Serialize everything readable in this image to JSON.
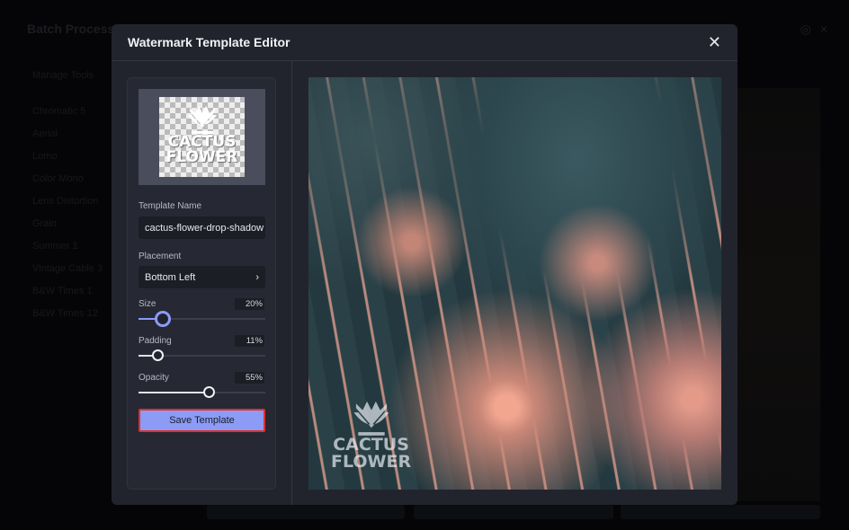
{
  "background": {
    "title": "Batch Process",
    "list": [
      "Manage Tools",
      "Chromatic 5",
      "Aerial",
      "Lomo",
      "Color Mono",
      "Lens Distortion",
      "Grain",
      "Summer 1",
      "Vintage Cable 3",
      "B&W Times 1",
      "B&W Times 12"
    ]
  },
  "modal": {
    "title": "Watermark Template Editor",
    "close": "✕"
  },
  "watermark": {
    "line1": "CACTUS",
    "line2": "FLOWER"
  },
  "form": {
    "template_name_label": "Template Name",
    "template_name_value": "cactus-flower-drop-shadow",
    "placement_label": "Placement",
    "placement_value": "Bottom Left",
    "placement_chevron": "›",
    "size_label": "Size",
    "size_value": "20%",
    "size": 20,
    "padding_label": "Padding",
    "padding_value": "11%",
    "padding": 11,
    "opacity_label": "Opacity",
    "opacity_value": "55%",
    "opacity": 55,
    "save_label": "Save Template"
  },
  "colors": {
    "accent": "#8c9bf5",
    "focus_outline": "#e0302d"
  }
}
